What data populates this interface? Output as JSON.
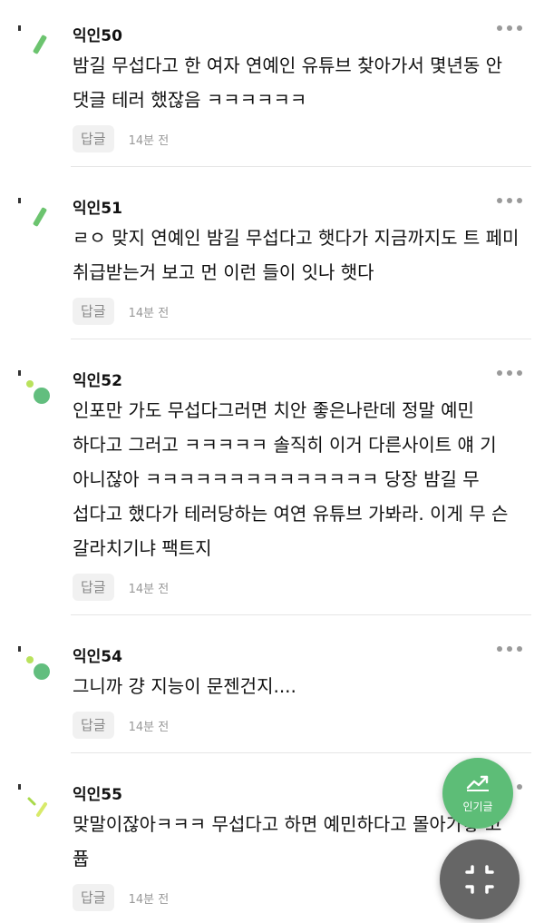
{
  "comments": [
    {
      "nickname": "익인50",
      "text": "밤길 무섭다고 한 여자 연예인 유튜브 찾아가서 몇년동 안 댓글 테러 했잖음 ㅋㅋㅋㅋㅋㅋ",
      "reply_label": "답글",
      "time": "14분 전",
      "avatar_icon": "leaf-avatar-icon"
    },
    {
      "nickname": "익인51",
      "text": "ㄹㅇ 맞지 연예인 밤길 무섭다고 햇다가 지금까지도 트 페미 취급받는거 보고 먼 이런 들이 잇나 햇다",
      "reply_label": "답글",
      "time": "14분 전",
      "avatar_icon": "leaf-avatar-icon"
    },
    {
      "nickname": "익인52",
      "text": "인포만 가도 무섭다그러면 치안 좋은나란데 정말 예민 하다고 그러고 ㅋㅋㅋㅋㅋ 솔직히 이거 다른사이트 얘 기 아니잖아 ㅋㅋㅋㅋㅋㅋㅋㅋㅋㅋㅋㅋㅋㅋ 당장 밤길 무 섭다고 했다가 테러당하는 여연 유튜브 가봐라. 이게 무 슨 갈라치기냐 팩트지",
      "reply_label": "답글",
      "time": "14분 전",
      "avatar_icon": "dots-avatar-icon"
    },
    {
      "nickname": "익인54",
      "text": "그니까 걍 지능이 문젠건지....",
      "reply_label": "답글",
      "time": "14분 전",
      "avatar_icon": "dots-avatar-icon"
    },
    {
      "nickname": "익인55",
      "text": "맞말이잖아ㅋㅋㅋ 무섭다고 하면 예민하다고 몰아가놓 고 퓹",
      "reply_label": "답글",
      "time": "14분 전",
      "avatar_icon": "sprout-avatar-icon"
    }
  ],
  "fab": {
    "hot_label": "인기글",
    "hot_icon": "trending-chart-icon",
    "collapse_icon": "collapse-arrows-icon"
  },
  "colors": {
    "accent_green": "#5dbd77",
    "fab_gray": "#666666"
  }
}
